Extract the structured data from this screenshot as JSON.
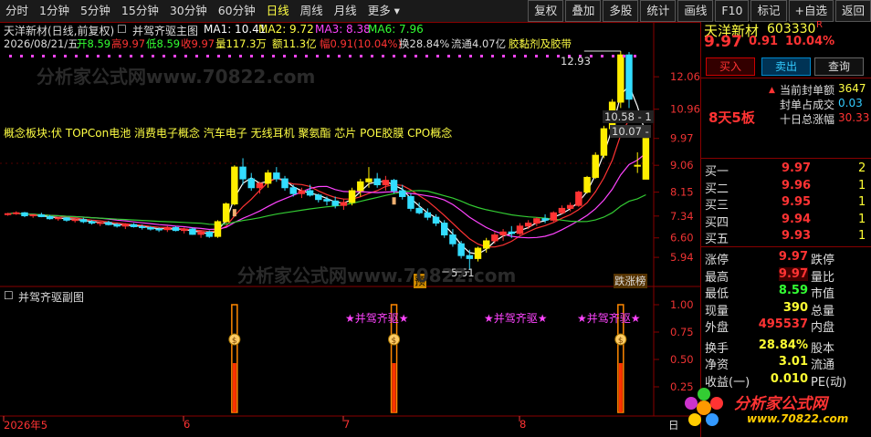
{
  "toolbar": {
    "left_tabs": [
      "分时",
      "1分钟",
      "5分钟",
      "15分钟",
      "30分钟",
      "60分钟",
      "日线",
      "周线",
      "月线",
      "更多"
    ],
    "selected_tab": "日线",
    "right_tools": [
      "复权",
      "叠加",
      "多股",
      "统计",
      "画线",
      "F10",
      "标记",
      "+自选",
      "返回"
    ]
  },
  "main_chart": {
    "stock_title": "天洋新材(日线,前复权)",
    "indicator_name": "并驾齐驱主图",
    "ma1": "MA1: 10.41",
    "ma2": "MA2: 9.72",
    "ma3": "MA3: 8.38",
    "ma6": "MA6: 7.96",
    "info_date": "2026/08/21/五",
    "info_open": "开8.59",
    "info_high": "高9.97",
    "info_low": "低8.59",
    "info_close": "收9.97",
    "info_volume": "量117.3万",
    "info_amount": "额11.3亿",
    "info_change": "幅0.91(10.04%)",
    "info_turnover": "换28.84%",
    "info_float": "流通4.07亿",
    "info_concept": "胶黏剂及胶带",
    "concept_line": "概念板块:伏 TOPCon电池 消费电子概念 汽车电子 无线耳机 聚氨酯 芯片 POE胶膜 CPO概念",
    "high_label": "12.93",
    "low_label": "5.51",
    "price_tag_1": "10.58 - 1",
    "price_tag_2": "10.07 -",
    "marker_yu": "预",
    "marker_zhangting": "跌涨榜",
    "y_ticks": [
      "12.06",
      "10.96",
      "9.97",
      "9.06",
      "8.15",
      "7.34",
      "6.60",
      "5.94"
    ],
    "watermark": "分析家公式网www.70822.com"
  },
  "sub_chart": {
    "title": "并驾齐驱副图",
    "y_ticks": [
      "1.00",
      "0.75",
      "0.50",
      "0.25"
    ],
    "signal_label": "★并驾齐驱★",
    "signal_icon": "$"
  },
  "x_axis": {
    "labels": [
      "2026年5",
      "6",
      "7",
      "8"
    ],
    "right_label": "日",
    "logo_text": "分析家公式网",
    "logo_url": "www.70822.com"
  },
  "chart_data": {
    "type": "candlestick",
    "title": "天洋新材(日线,前复权)",
    "ylim": [
      5.51,
      12.93
    ],
    "candles": [
      [
        7.4,
        7.45,
        7.35,
        7.42
      ],
      [
        7.42,
        7.5,
        7.38,
        7.45
      ],
      [
        7.45,
        7.48,
        7.3,
        7.35
      ],
      [
        7.35,
        7.4,
        7.28,
        7.38
      ],
      [
        7.38,
        7.45,
        7.3,
        7.32
      ],
      [
        7.32,
        7.38,
        7.22,
        7.25
      ],
      [
        7.25,
        7.3,
        7.18,
        7.28
      ],
      [
        7.28,
        7.3,
        7.15,
        7.2
      ],
      [
        7.2,
        7.25,
        7.12,
        7.22
      ],
      [
        7.22,
        7.28,
        7.1,
        7.15
      ],
      [
        7.15,
        7.2,
        7.05,
        7.1
      ],
      [
        7.1,
        7.15,
        7.0,
        7.12
      ],
      [
        7.12,
        7.18,
        7.02,
        7.05
      ],
      [
        7.05,
        7.1,
        6.95,
        7.0
      ],
      [
        7.0,
        7.1,
        6.9,
        7.05
      ],
      [
        7.05,
        7.1,
        6.95,
        6.98
      ],
      [
        6.98,
        7.05,
        6.88,
        6.95
      ],
      [
        6.95,
        7.0,
        6.85,
        6.9
      ],
      [
        6.9,
        6.95,
        6.8,
        6.88
      ],
      [
        6.88,
        7.0,
        6.8,
        6.95
      ],
      [
        6.95,
        7.0,
        6.82,
        6.85
      ],
      [
        6.85,
        6.95,
        6.75,
        6.9
      ],
      [
        6.9,
        6.95,
        6.7,
        6.72
      ],
      [
        6.72,
        6.85,
        6.6,
        6.8
      ],
      [
        6.8,
        6.85,
        6.6,
        6.65
      ],
      [
        6.65,
        7.2,
        6.6,
        7.15
      ],
      [
        7.15,
        7.8,
        7.1,
        7.75
      ],
      [
        7.75,
        9.06,
        7.7,
        9.0
      ],
      [
        9.0,
        9.3,
        8.4,
        8.6
      ],
      [
        8.6,
        8.8,
        8.2,
        8.3
      ],
      [
        8.3,
        8.5,
        8.1,
        8.45
      ],
      [
        8.45,
        8.9,
        8.3,
        8.8
      ],
      [
        8.8,
        9.0,
        8.5,
        8.6
      ],
      [
        8.6,
        8.7,
        8.2,
        8.3
      ],
      [
        8.3,
        8.4,
        8.0,
        8.1
      ],
      [
        8.1,
        8.3,
        7.95,
        8.2
      ],
      [
        8.2,
        8.4,
        8.0,
        8.05
      ],
      [
        8.05,
        8.1,
        7.8,
        7.9
      ],
      [
        7.9,
        8.0,
        7.7,
        7.85
      ],
      [
        7.85,
        8.0,
        7.6,
        7.7
      ],
      [
        7.7,
        7.9,
        7.55,
        7.8
      ],
      [
        7.8,
        8.3,
        7.7,
        8.2
      ],
      [
        8.2,
        8.6,
        8.0,
        8.5
      ],
      [
        8.5,
        9.0,
        8.3,
        8.6
      ],
      [
        8.6,
        8.8,
        8.3,
        8.4
      ],
      [
        8.4,
        8.7,
        8.2,
        8.55
      ],
      [
        8.55,
        8.6,
        8.1,
        8.2
      ],
      [
        8.2,
        8.4,
        7.9,
        8.0
      ],
      [
        8.0,
        8.1,
        7.5,
        7.6
      ],
      [
        7.6,
        7.8,
        7.4,
        7.45
      ],
      [
        7.45,
        7.6,
        7.2,
        7.3
      ],
      [
        7.3,
        7.4,
        7.0,
        7.1
      ],
      [
        7.1,
        7.2,
        6.6,
        6.7
      ],
      [
        6.7,
        6.9,
        6.3,
        6.4
      ],
      [
        6.4,
        6.5,
        5.9,
        6.0
      ],
      [
        6.0,
        6.2,
        5.51,
        5.9
      ],
      [
        5.9,
        6.3,
        5.8,
        6.25
      ],
      [
        6.25,
        6.6,
        6.1,
        6.5
      ],
      [
        6.5,
        6.8,
        6.4,
        6.7
      ],
      [
        6.7,
        6.9,
        6.5,
        6.8
      ],
      [
        6.8,
        7.0,
        6.6,
        6.75
      ],
      [
        6.75,
        7.1,
        6.7,
        7.0
      ],
      [
        7.0,
        7.2,
        6.9,
        7.1
      ],
      [
        7.1,
        7.3,
        7.0,
        7.25
      ],
      [
        7.25,
        7.4,
        7.1,
        7.2
      ],
      [
        7.2,
        7.5,
        7.15,
        7.45
      ],
      [
        7.45,
        7.7,
        7.4,
        7.6
      ],
      [
        7.6,
        7.8,
        7.5,
        7.7
      ],
      [
        7.7,
        8.2,
        7.65,
        8.15
      ],
      [
        8.15,
        8.7,
        8.1,
        8.65
      ],
      [
        8.65,
        9.5,
        8.6,
        9.4
      ],
      [
        9.4,
        10.4,
        9.3,
        10.3
      ],
      [
        10.3,
        11.3,
        10.2,
        11.2
      ],
      [
        11.2,
        12.93,
        11.0,
        12.8
      ],
      [
        12.8,
        12.9,
        11.0,
        11.3
      ],
      [
        9.06,
        9.5,
        8.8,
        9.06
      ],
      [
        8.59,
        9.97,
        8.59,
        9.97
      ]
    ],
    "signals": [
      27,
      46,
      73
    ],
    "y_ticks": [
      12.06,
      10.96,
      9.97,
      9.06,
      8.15,
      7.34,
      6.6,
      5.94
    ]
  },
  "panel": {
    "name": "天洋新材",
    "code": "603330",
    "r_tag": "R",
    "price": "9.97",
    "change": "0.91",
    "change_pct": "10.04%",
    "buy_btn": "买入",
    "sell_btn": "卖出",
    "query_btn": "查询",
    "limit_tag": "8天5板",
    "seal_labels": [
      "当前封单额",
      "封单占成交",
      "十日总涨幅"
    ],
    "seal_values": [
      "3647",
      "0.03",
      "30.33"
    ],
    "bids": [
      {
        "label": "买一",
        "price": "9.97",
        "vol": "2"
      },
      {
        "label": "买二",
        "price": "9.96",
        "vol": "1"
      },
      {
        "label": "买三",
        "price": "9.95",
        "vol": "1"
      },
      {
        "label": "买四",
        "price": "9.94",
        "vol": "1"
      },
      {
        "label": "买五",
        "price": "9.93",
        "vol": "1"
      }
    ],
    "stats": [
      {
        "k1": "涨停",
        "v1": "9.97",
        "k2": "跌停"
      },
      {
        "k1": "最高",
        "v1": "9.97",
        "k2": "量比"
      },
      {
        "k1": "最低",
        "v1": "8.59",
        "k2": "市值"
      },
      {
        "k1": "现量",
        "v1": "390",
        "k2": "总量"
      },
      {
        "k1": "外盘",
        "v1": "495537",
        "k2": "内盘"
      },
      {
        "k1": "换手",
        "v1": "28.84%",
        "k2": "股本"
      },
      {
        "k1": "净资",
        "v1": "3.01",
        "k2": "流通"
      },
      {
        "k1": "收益(一)",
        "v1": "0.010",
        "k2": "PE(动)"
      }
    ],
    "colors": {
      "up": "#ff3333",
      "down": "#33ff33",
      "accent": "#ffff33",
      "border": "#880000"
    }
  }
}
